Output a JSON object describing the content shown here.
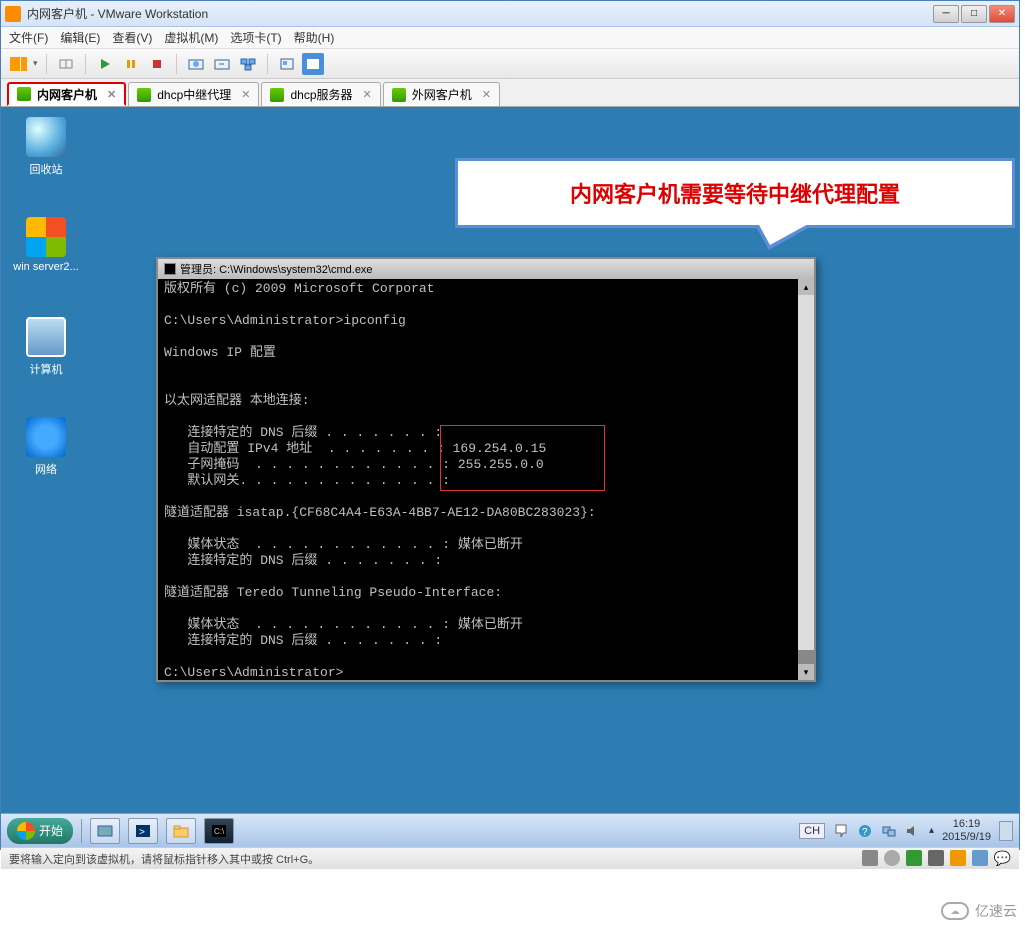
{
  "vmware": {
    "title": "内网客户机 - VMware Workstation",
    "menu": {
      "file": "文件(F)",
      "edit": "编辑(E)",
      "view": "查看(V)",
      "vm": "虚拟机(M)",
      "tabs": "选项卡(T)",
      "help": "帮助(H)"
    },
    "tabs": [
      {
        "label": "内网客户机",
        "active": true
      },
      {
        "label": "dhcp中继代理",
        "active": false
      },
      {
        "label": "dhcp服务器",
        "active": false
      },
      {
        "label": "外网客户机",
        "active": false
      }
    ],
    "status": "要将输入定向到该虚拟机，请将鼠标指针移入其中或按 Ctrl+G。"
  },
  "desktop": {
    "icons": {
      "recycle": "回收站",
      "winserver": "win server2...",
      "computer": "计算机",
      "network": "网络"
    }
  },
  "cmd": {
    "title": "管理员: C:\\Windows\\system32\\cmd.exe",
    "lines": {
      "l1": "版权所有 (c) 2009 Microsoft Corporat",
      "l2": "",
      "l3": "C:\\Users\\Administrator>ipconfig",
      "l4": "",
      "l5": "Windows IP 配置",
      "l6": "",
      "l7": "",
      "l8": "以太网适配器 本地连接:",
      "l9": "",
      "l10": "   连接特定的 DNS 后缀 . . . . . . . :",
      "l11": "   自动配置 IPv4 地址  . . . . . . . : 169.254.0.15",
      "l12": "   子网掩码  . . . . . . . . . . . . : 255.255.0.0",
      "l13": "   默认网关. . . . . . . . . . . . . :",
      "l14": "",
      "l15": "隧道适配器 isatap.{CF68C4A4-E63A-4BB7-AE12-DA80BC283023}:",
      "l16": "",
      "l17": "   媒体状态  . . . . . . . . . . . . : 媒体已断开",
      "l18": "   连接特定的 DNS 后缀 . . . . . . . :",
      "l19": "",
      "l20": "隧道适配器 Teredo Tunneling Pseudo-Interface:",
      "l21": "",
      "l22": "   媒体状态  . . . . . . . . . . . . : 媒体已断开",
      "l23": "   连接特定的 DNS 后缀 . . . . . . . :",
      "l24": "",
      "l25": "C:\\Users\\Administrator>"
    }
  },
  "callout": {
    "text": "内网客户机需要等待中继代理配置"
  },
  "guest_taskbar": {
    "start": "开始",
    "lang": "CH",
    "time": "16:19",
    "date": "2015/9/19"
  },
  "watermark": {
    "text": "亿速云"
  }
}
